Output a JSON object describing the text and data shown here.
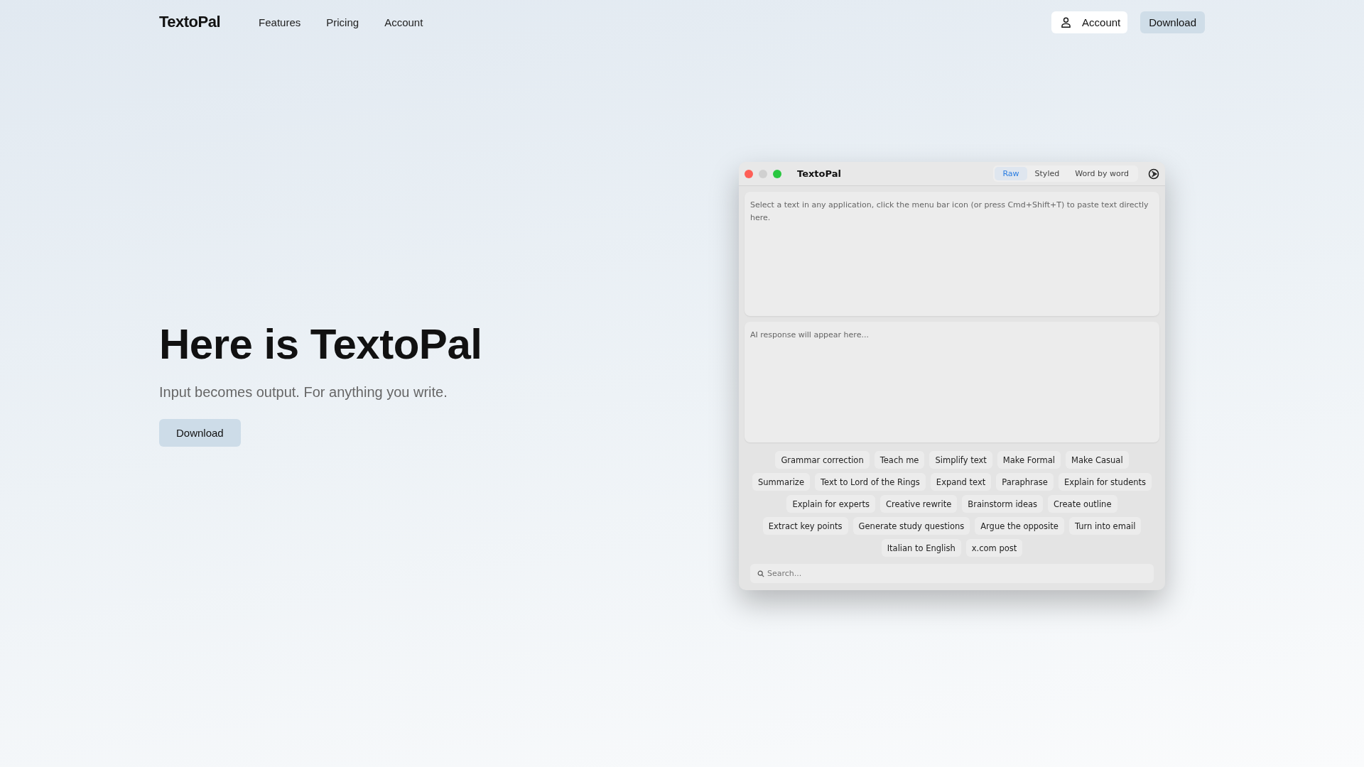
{
  "nav": {
    "logo": "TextoPal",
    "links": [
      "Features",
      "Pricing",
      "Account"
    ],
    "account_button": "Account",
    "download_button": "Download"
  },
  "hero": {
    "title": "Here is TextoPal",
    "subtitle": "Input becomes output. For anything you write.",
    "button": "Download"
  },
  "app_window": {
    "title": "TextoPal",
    "tabs": [
      {
        "label": "Raw",
        "selected": true
      },
      {
        "label": "Styled",
        "selected": false
      },
      {
        "label": "Word by word",
        "selected": false
      }
    ],
    "input": {
      "placeholder": "Select a text in any application, click the menu bar icon (or press Cmd+Shift+T) to paste text directly here."
    },
    "output": {
      "placeholder": "AI response will appear here..."
    },
    "action_rows": [
      [
        "Grammar correction",
        "Teach me",
        "Simplify text",
        "Make Formal",
        "Make Casual"
      ],
      [
        "Summarize",
        "Text to Lord of the Rings",
        "Expand text",
        "Paraphrase",
        "Explain for students"
      ],
      [
        "Explain for experts",
        "Creative rewrite",
        "Brainstorm ideas",
        "Create outline"
      ],
      [
        "Extract key points",
        "Generate study questions",
        "Argue the opposite",
        "Turn into email"
      ],
      [
        "Italian to English",
        "x.com post"
      ]
    ],
    "search": {
      "placeholder": "Search..."
    }
  }
}
